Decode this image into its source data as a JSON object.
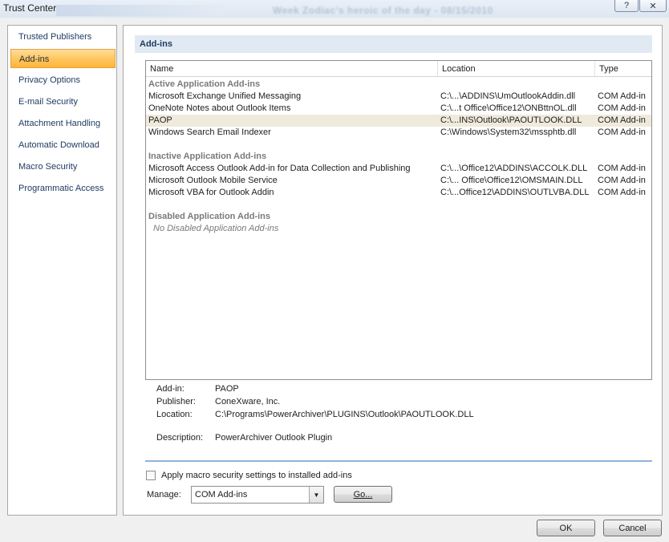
{
  "window": {
    "title": "Trust Center",
    "background_text": "Week Zodiac's heroic of the day - 08/15/2010",
    "help_label": "?",
    "close_label": "✕"
  },
  "nav": {
    "items": [
      {
        "label": "Trusted Publishers",
        "selected": false
      },
      {
        "label": "Add-ins",
        "selected": true
      },
      {
        "label": "Privacy Options",
        "selected": false
      },
      {
        "label": "E-mail Security",
        "selected": false
      },
      {
        "label": "Attachment Handling",
        "selected": false
      },
      {
        "label": "Automatic Download",
        "selected": false
      },
      {
        "label": "Macro Security",
        "selected": false
      },
      {
        "label": "Programmatic Access",
        "selected": false
      }
    ]
  },
  "main": {
    "section_title": "Add-ins",
    "list": {
      "columns": {
        "name": "Name",
        "location": "Location",
        "type": "Type"
      },
      "groups": {
        "active": {
          "label": "Active Application Add-ins",
          "rows": [
            {
              "name": "Microsoft Exchange Unified Messaging",
              "location": "C:\\...\\ADDINS\\UmOutlookAddin.dll",
              "type": "COM Add-in"
            },
            {
              "name": "OneNote Notes about Outlook Items",
              "location": "C:\\...t Office\\Office12\\ONBttnOL.dll",
              "type": "COM Add-in"
            },
            {
              "name": "PAOP",
              "location": "C:\\...INS\\Outlook\\PAOUTLOOK.DLL",
              "type": "COM Add-in"
            },
            {
              "name": "Windows Search Email Indexer",
              "location": "C:\\Windows\\System32\\mssphtb.dll",
              "type": "COM Add-in"
            }
          ]
        },
        "inactive": {
          "label": "Inactive Application Add-ins",
          "rows": [
            {
              "name": "Microsoft Access Outlook Add-in for Data Collection and Publishing",
              "location": "C:\\...\\Office12\\ADDINS\\ACCOLK.DLL",
              "type": "COM Add-in"
            },
            {
              "name": "Microsoft Outlook Mobile Service",
              "location": "C:\\... Office\\Office12\\OMSMAIN.DLL",
              "type": "COM Add-in"
            },
            {
              "name": "Microsoft VBA for Outlook Addin",
              "location": "C:\\...Office12\\ADDINS\\OUTLVBA.DLL",
              "type": "COM Add-in"
            }
          ]
        },
        "disabled": {
          "label": "Disabled Application Add-ins",
          "empty_text": "No Disabled Application Add-ins"
        }
      },
      "selected_row": "PAOP",
      "highlight_color": "#efeadb"
    },
    "details": {
      "addin_label": "Add-in:",
      "addin_value": "PAOP",
      "publisher_label": "Publisher:",
      "publisher_value": "ConeXware, Inc.",
      "location_label": "Location:",
      "location_value": "C:\\Programs\\PowerArchiver\\PLUGINS\\Outlook\\PAOUTLOOK.DLL",
      "description_label": "Description:",
      "description_value": "PowerArchiver Outlook Plugin"
    },
    "macro_checkbox": {
      "label": "Apply macro security settings to installed add-ins",
      "checked": false
    },
    "manage": {
      "label": "Manage:",
      "value": "COM Add-ins",
      "go_label": "Go..."
    }
  },
  "footer": {
    "ok_label": "OK",
    "cancel_label": "Cancel"
  },
  "colors": {
    "selected_nav_gradient": [
      "#ffdc9a",
      "#ffb43a"
    ],
    "section_header_bg": "#e1e9f3",
    "separator": "#8fb3d9"
  }
}
